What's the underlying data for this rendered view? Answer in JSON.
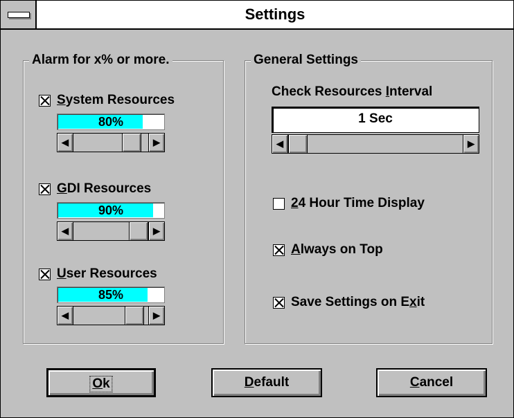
{
  "window": {
    "title": "Settings"
  },
  "alarm_group": {
    "legend": "Alarm for x% or more.",
    "items": [
      {
        "label_pre": "",
        "label_key": "S",
        "label_post": "ystem Resources",
        "checked": true,
        "value_text": "80%",
        "level": 0.8
      },
      {
        "label_pre": "",
        "label_key": "G",
        "label_post": "DI Resources",
        "checked": true,
        "value_text": "90%",
        "level": 0.9
      },
      {
        "label_pre": "",
        "label_key": "U",
        "label_post": "ser Resources",
        "checked": true,
        "value_text": "85%",
        "level": 0.85
      }
    ]
  },
  "general_group": {
    "legend": "General Settings",
    "interval_label_pre": "Check Resources ",
    "interval_label_key": "I",
    "interval_label_post": "nterval",
    "interval_value": "1 Sec",
    "options": [
      {
        "label_pre": "",
        "label_key": "2",
        "label_post": "4 Hour Time Display",
        "checked": false
      },
      {
        "label_pre": "",
        "label_key": "A",
        "label_post": "lways on Top",
        "checked": true
      },
      {
        "label_pre": "Save Settings on E",
        "label_key": "x",
        "label_post": "it",
        "checked": true
      }
    ]
  },
  "buttons": {
    "ok_key": "O",
    "ok_post": "k",
    "default_key": "D",
    "default_post": "efault",
    "cancel_key": "C",
    "cancel_post": "ancel"
  },
  "icons": {
    "scroll_left": "arrow-left-icon",
    "scroll_right": "arrow-right-icon",
    "system_menu": "system-menu-icon"
  },
  "colors": {
    "gauge_fill": "#00ffff",
    "face": "#c0c0c0"
  }
}
